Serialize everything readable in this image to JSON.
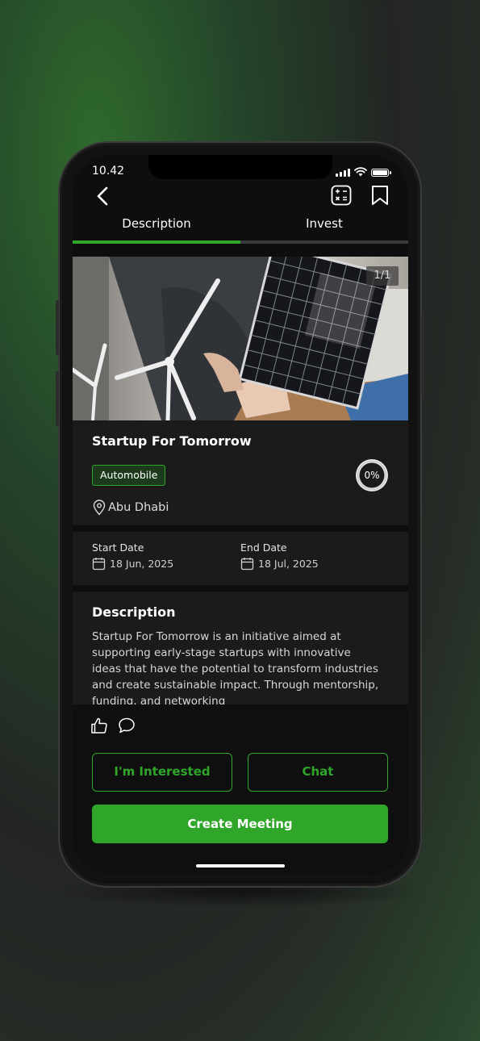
{
  "status_bar": {
    "time": "10.42"
  },
  "header": {
    "back_icon": "chevron-left-icon",
    "calculator_icon": "calculator-icon",
    "bookmark_icon": "bookmark-icon"
  },
  "tabs": [
    {
      "label": "Description",
      "active": true
    },
    {
      "label": "Invest",
      "active": false
    }
  ],
  "gallery": {
    "counter": "1/1"
  },
  "project": {
    "title": "Startup For Tomorrow",
    "category": "Automobile",
    "progress_label": "0%",
    "progress_value": 0,
    "location": "Abu Dhabi"
  },
  "dates": {
    "start_label": "Start Date",
    "start_value": "18 Jun, 2025",
    "end_label": "End Date",
    "end_value": "18 Jul, 2025"
  },
  "description": {
    "heading": "Description",
    "body": "Startup For Tomorrow is an initiative aimed at supporting early-stage startups with innovative ideas that have the potential to transform industries and create sustainable impact. Through mentorship, funding, and networking"
  },
  "actions": {
    "interested_label": "I'm Interested",
    "chat_label": "Chat",
    "create_meeting_label": "Create Meeting"
  },
  "colors": {
    "accent": "#2fa52a",
    "background": "#0e0e0e",
    "card": "#1b1b1b"
  }
}
